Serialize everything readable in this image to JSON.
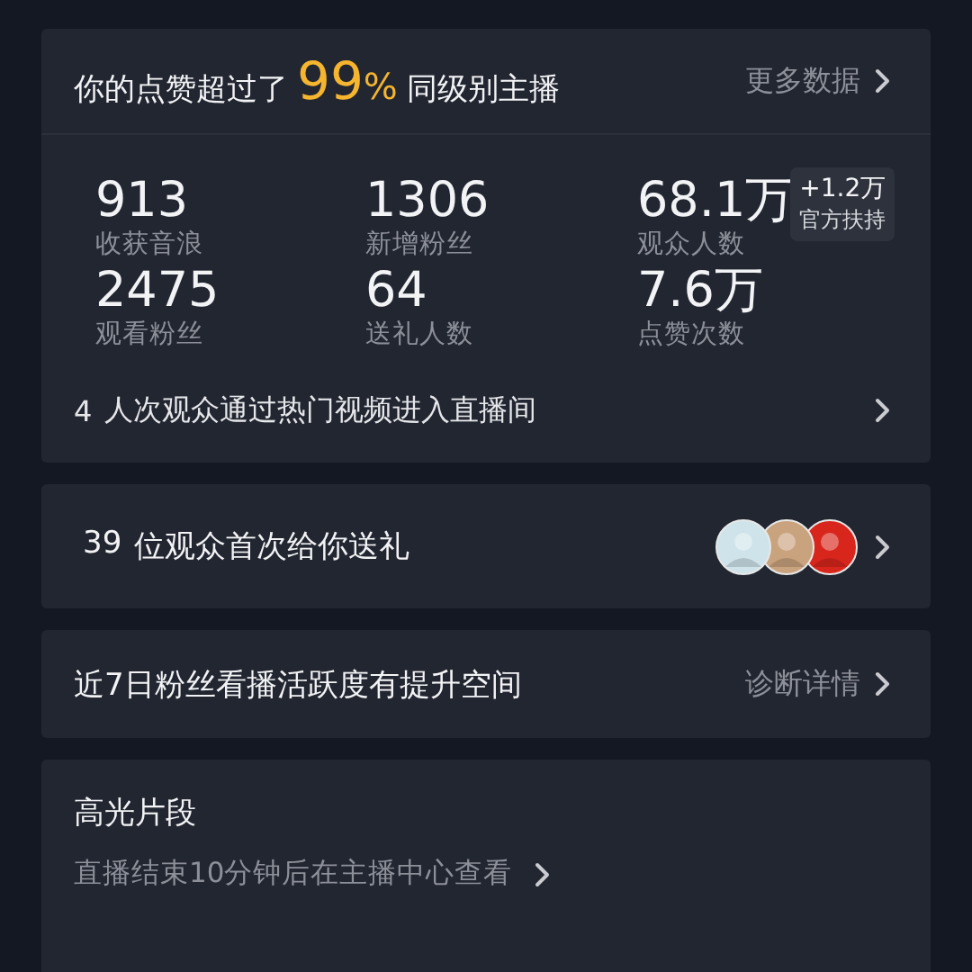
{
  "summary": {
    "title_prefix": "你的点赞超过了",
    "highlight": "99",
    "highlight_unit": "%",
    "title_suffix": "同级别主播",
    "link": "更多数据",
    "stats": [
      {
        "value": "913",
        "label": "收获音浪"
      },
      {
        "value": "1306",
        "label": "新增粉丝"
      },
      {
        "value": "68.1万",
        "label": "观众人数",
        "badge": {
          "value": "+1.2万",
          "note": "官方扶持"
        }
      },
      {
        "value": "2475",
        "label": "观看粉丝"
      },
      {
        "value": "64",
        "label": "送礼人数"
      },
      {
        "value": "7.6万",
        "label": "点赞次数"
      }
    ],
    "footer_count": "4",
    "footer_text": "人次观众通过热门视频进入直播间"
  },
  "gift_row": {
    "count": "39",
    "text": "位观众首次给你送礼",
    "avatars": [
      {
        "kind": "avatar"
      },
      {
        "kind": "avatar"
      },
      {
        "kind": "avatar"
      }
    ]
  },
  "fans_row": {
    "text": "近7日粉丝看播活跃度有提升空间",
    "link": "诊断详情"
  },
  "highlights": {
    "title": "高光片段",
    "note": "直播结束10分钟后在主播中心查看"
  }
}
